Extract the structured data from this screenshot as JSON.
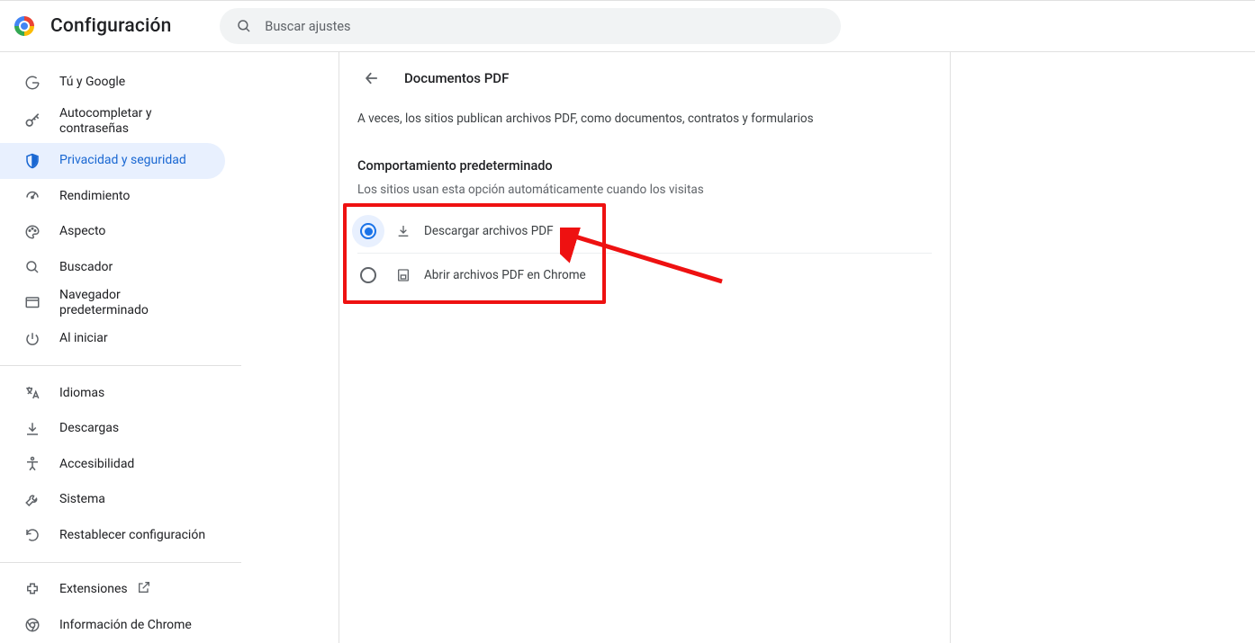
{
  "header": {
    "title": "Configuración",
    "search_placeholder": "Buscar ajustes"
  },
  "sidebar": {
    "items": [
      {
        "id": "you-and-google",
        "label": "Tú y Google"
      },
      {
        "id": "autofill",
        "label": "Autocompletar y contraseñas"
      },
      {
        "id": "privacy",
        "label": "Privacidad y seguridad",
        "active": true
      },
      {
        "id": "performance",
        "label": "Rendimiento"
      },
      {
        "id": "appearance",
        "label": "Aspecto"
      },
      {
        "id": "search-engine",
        "label": "Buscador"
      },
      {
        "id": "default-browser",
        "label": "Navegador predeterminado"
      },
      {
        "id": "on-startup",
        "label": "Al iniciar"
      }
    ],
    "items2": [
      {
        "id": "languages",
        "label": "Idiomas"
      },
      {
        "id": "downloads",
        "label": "Descargas"
      },
      {
        "id": "accessibility",
        "label": "Accesibilidad"
      },
      {
        "id": "system",
        "label": "Sistema"
      },
      {
        "id": "reset",
        "label": "Restablecer configuración"
      }
    ],
    "items3": [
      {
        "id": "extensions",
        "label": "Extensiones"
      },
      {
        "id": "about",
        "label": "Información de Chrome"
      }
    ]
  },
  "page": {
    "title": "Documentos PDF",
    "description": "A veces, los sitios publican archivos PDF, como documentos, contratos y formularios",
    "section_title": "Comportamiento predeterminado",
    "section_sub": "Los sitios usan esta opción automáticamente cuando los visitas",
    "options": [
      {
        "id": "download-pdf",
        "label": "Descargar archivos PDF",
        "selected": true
      },
      {
        "id": "open-pdf",
        "label": "Abrir archivos PDF en Chrome",
        "selected": false
      }
    ]
  }
}
